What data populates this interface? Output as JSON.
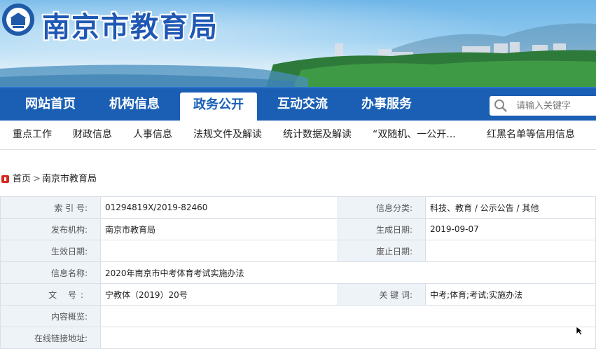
{
  "site": {
    "title": "南京市教育局",
    "colors": {
      "brand": "#1a5fb4",
      "active_tab_bg": "#ffffff",
      "label_bg": "#eef3f8",
      "breadcrumb_icon": "#d7291f"
    }
  },
  "mainnav": {
    "items": [
      {
        "label": "网站首页"
      },
      {
        "label": "机构信息"
      },
      {
        "label": "政务公开",
        "active": true
      },
      {
        "label": "互动交流"
      },
      {
        "label": "办事服务"
      }
    ],
    "search_placeholder": "请输入关键字"
  },
  "subnav": {
    "items": [
      {
        "label": "重点工作"
      },
      {
        "label": "财政信息"
      },
      {
        "label": "人事信息"
      },
      {
        "label": "法规文件及解读"
      },
      {
        "label": "统计数据及解读"
      },
      {
        "label": "“双随机、一公开..."
      },
      {
        "label": "红黑名单等信用信息"
      }
    ]
  },
  "breadcrumb": {
    "home": "首页",
    "separator": ">",
    "current": "南京市教育局"
  },
  "info": {
    "index_label": "索 引 号:",
    "index_value": "01294819X/2019-82460",
    "category_label": "信息分类:",
    "category_value": "科技、教育 / 公示公告 / 其他",
    "publisher_label": "发布机构:",
    "publisher_value": "南京市教育局",
    "created_label": "生成日期:",
    "created_value": "2019-09-07",
    "effective_label": "生效日期:",
    "effective_value": "",
    "expired_label": "废止日期:",
    "expired_value": "",
    "name_label": "信息名称:",
    "name_value": "2020年南京市中考体育考试实施办法",
    "docno_label": "文 号:",
    "docno_value": "宁教体（2019）20号",
    "keywords_label": "关 键 词:",
    "keywords_value": "中考;体育;考试;实施办法",
    "summary_label": "内容概览:",
    "summary_value": "",
    "link_label": "在线链接地址:",
    "link_value": ""
  }
}
